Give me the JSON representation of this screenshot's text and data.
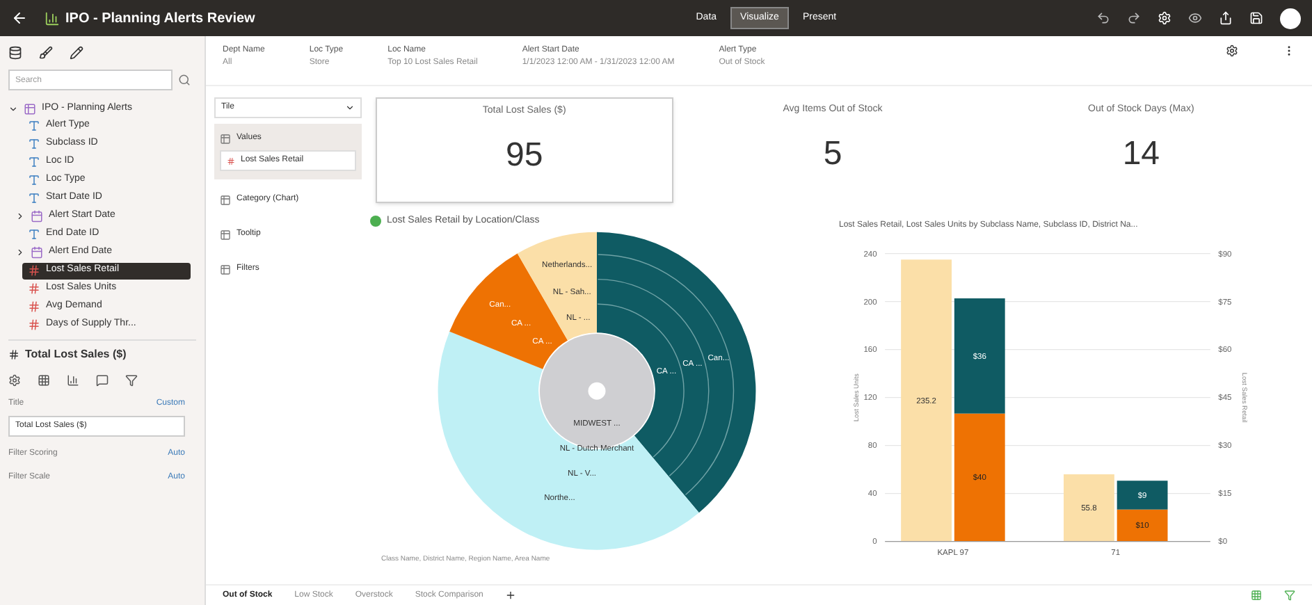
{
  "title": "IPO - Planning Alerts Review",
  "modes": [
    {
      "label": "Data",
      "selected": false
    },
    {
      "label": "Visualize",
      "selected": true
    },
    {
      "label": "Present",
      "selected": false
    }
  ],
  "search": {
    "placeholder": "Search"
  },
  "tree": {
    "label": "IPO - Planning Alerts",
    "expanded": true,
    "children": [
      {
        "label": "Alert Type",
        "kind": "attribute",
        "selected": false
      },
      {
        "label": "Subclass ID",
        "kind": "attribute",
        "selected": false
      },
      {
        "label": "Loc ID",
        "kind": "attribute",
        "selected": false
      },
      {
        "label": "Loc Type",
        "kind": "attribute",
        "selected": false
      },
      {
        "label": "Start Date ID",
        "kind": "attribute",
        "selected": false
      },
      {
        "label": "Alert Start Date",
        "kind": "date",
        "selected": false
      },
      {
        "label": "End Date ID",
        "kind": "attribute",
        "selected": false
      },
      {
        "label": "Alert End Date",
        "kind": "date",
        "selected": false
      },
      {
        "label": "Lost Sales Retail",
        "kind": "measure",
        "selected": true
      },
      {
        "label": "Lost Sales Units",
        "kind": "measure",
        "selected": false
      },
      {
        "label": "Avg Demand",
        "kind": "measure",
        "selected": false
      },
      {
        "label": "Days of Supply Thr...",
        "kind": "measure",
        "selected": false
      }
    ]
  },
  "properties": {
    "heading": "Total Lost Sales ($)",
    "rows": [
      {
        "label": "Title",
        "value": "Custom",
        "kind": "link"
      },
      {
        "value": "Total Lost Sales ($)",
        "kind": "field"
      },
      {
        "label": "Filter Scoring",
        "value": "Auto",
        "kind": "link"
      },
      {
        "label": "Filter Scale",
        "value": "Auto",
        "kind": "link"
      }
    ]
  },
  "filters": [
    {
      "label": "Dept Name",
      "value": "All"
    },
    {
      "label": "Loc Type",
      "value": "Store"
    },
    {
      "label": "Loc Name",
      "value": "Top 10 Lost Sales Retail"
    },
    {
      "label": "Alert Start Date",
      "value": "1/1/2023 12:00 AM - 1/31/2023 12:00 AM"
    },
    {
      "label": "Alert Type",
      "value": "Out of Stock"
    }
  ],
  "grammar": {
    "type": "Tile",
    "sections": [
      {
        "label": "Values",
        "pill": "Lost Sales Retail",
        "selected": true
      },
      {
        "label": "Category (Chart)",
        "selected": false
      },
      {
        "label": "Tooltip",
        "selected": false
      },
      {
        "label": "Filters",
        "selected": false
      }
    ]
  },
  "tiles": [
    {
      "label": "Total Lost Sales ($)",
      "value": "95",
      "selected": true
    },
    {
      "label": "Avg Items Out of Stock",
      "value": "5",
      "selected": false
    },
    {
      "label": "Out of Stock Days (Max)",
      "value": "14",
      "selected": false
    }
  ],
  "sunburst": {
    "title": "Lost Sales Retail by Location/Class",
    "footer": "Class Name, District Name, Region Name, Area Name",
    "labels": [
      "Netherlands...",
      "NL - Sah...",
      "NL - ...",
      "Can...",
      "CA ...",
      "CA ...",
      "Can...",
      "CA ...",
      "CA ...",
      "MIDWEST ...",
      "NL - Dutch Merchant",
      "NL - V...",
      "Northe..."
    ]
  },
  "bar_chart": {
    "chart_data": {
      "type": "bar",
      "stacked": true,
      "grid": true,
      "title": "Lost Sales Retail, Lost Sales Units by Subclass Name, Subclass ID, District Na...",
      "ylabel": "Lost Sales Units",
      "categories": [
        "KAPL 97",
        "71"
      ],
      "series": [
        {
          "color": "#fbdfa8",
          "axis": "y",
          "values": [
            235,
            56
          ]
        },
        {
          "color": "#ee7203",
          "axis": "y2",
          "values": [
            40,
            10
          ]
        },
        {
          "color": "#0f5b63",
          "axis": "y2",
          "values": [
            36,
            9
          ]
        }
      ],
      "ylim": [
        0,
        240
      ],
      "y2lim": [
        0,
        90
      ],
      "yticks": [
        0,
        40,
        80,
        120,
        160,
        200,
        240
      ],
      "y2ticks": [
        {
          "value": 0,
          "label": "$0"
        },
        {
          "value": 15,
          "label": "$15"
        },
        {
          "value": 30,
          "label": "$30"
        },
        {
          "value": 45,
          "label": "$45"
        },
        {
          "value": 60,
          "label": "$60"
        },
        {
          "value": 75,
          "label": "$75"
        },
        {
          "value": 90,
          "label": "$90"
        }
      ],
      "y2label": "Lost Sales Retail",
      "value_labels": [
        "235.2",
        "55.8",
        "$40",
        "$10",
        "$36",
        "$9"
      ]
    }
  },
  "sheets": [
    {
      "label": "Out of Stock",
      "selected": true
    },
    {
      "label": "Low Stock",
      "selected": false
    },
    {
      "label": "Overstock",
      "selected": false
    },
    {
      "label": "Stock Comparison",
      "selected": false
    }
  ]
}
